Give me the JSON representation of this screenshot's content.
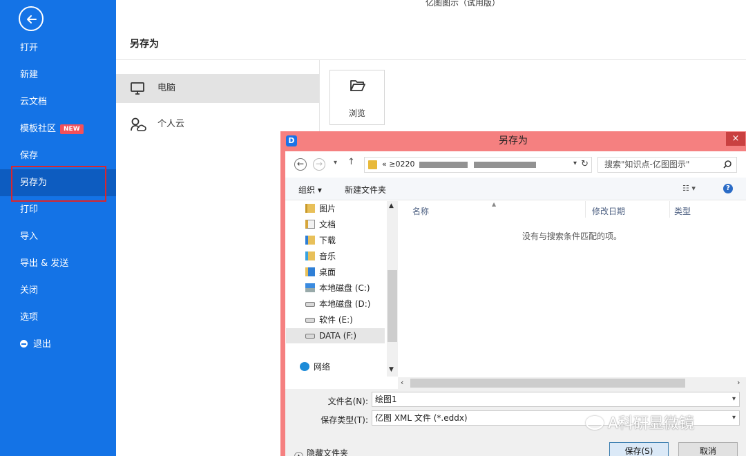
{
  "app": {
    "title": "亿图图示（试用版）"
  },
  "sidebar": {
    "back_icon": "back-arrow-icon",
    "items": [
      {
        "label": "打开"
      },
      {
        "label": "新建"
      },
      {
        "label": "云文档"
      },
      {
        "label": "模板社区",
        "badge": "NEW"
      },
      {
        "label": "保存"
      },
      {
        "label": "另存为",
        "active": true
      },
      {
        "label": "打印"
      },
      {
        "label": "导入"
      },
      {
        "label": "导出 & 发送"
      },
      {
        "label": "关闭"
      },
      {
        "label": "选项"
      },
      {
        "label": "退出",
        "icon": "exit-icon"
      }
    ],
    "colors": {
      "background": "#1473e6",
      "active": "#0d5cc0",
      "highlight_box": "#d9262d",
      "badge": "#f4505a"
    }
  },
  "main": {
    "title": "另存为",
    "locations": [
      {
        "label": "电脑",
        "icon": "computer-icon",
        "active": true
      },
      {
        "label": "个人云",
        "icon": "personal-cloud-icon"
      }
    ],
    "browse": {
      "label": "浏览",
      "icon": "folder-open-icon"
    }
  },
  "dialog": {
    "title": "另存为",
    "close_label": "×",
    "address": {
      "prefix": "«",
      "path_visible": "≥0220",
      "blurred": true
    },
    "search_placeholder": "搜索\"知识点-亿图图示\"",
    "toolbar": {
      "organize": "组织 ▾",
      "new_folder": "新建文件夹"
    },
    "tree": [
      {
        "label": "图片",
        "icon": "pictures-folder-icon"
      },
      {
        "label": "文档",
        "icon": "documents-folder-icon"
      },
      {
        "label": "下载",
        "icon": "downloads-folder-icon"
      },
      {
        "label": "音乐",
        "icon": "music-folder-icon"
      },
      {
        "label": "桌面",
        "icon": "desktop-folder-icon"
      },
      {
        "label": "本地磁盘 (C:)",
        "icon": "system-drive-icon"
      },
      {
        "label": "本地磁盘 (D:)",
        "icon": "drive-icon"
      },
      {
        "label": "软件 (E:)",
        "icon": "drive-icon"
      },
      {
        "label": "DATA (F:)",
        "icon": "drive-icon",
        "selected": true
      },
      {
        "label": "网络",
        "icon": "network-icon"
      }
    ],
    "columns": [
      "名称",
      "修改日期",
      "类型"
    ],
    "empty_message": "没有与搜索条件匹配的项。",
    "filename_label": "文件名(N):",
    "filename_value": "绘图1",
    "filetype_label": "保存类型(T):",
    "filetype_value": "亿图 XML 文件 (*.eddx)",
    "hide_folders": "隐藏文件夹",
    "save_button": "保存(S)",
    "cancel_button": "取消",
    "colors": {
      "frame": "#f58080",
      "close": "#c94040",
      "primary_button": "#dbe9f7"
    }
  },
  "watermark": {
    "text": "A科研显微镜"
  }
}
